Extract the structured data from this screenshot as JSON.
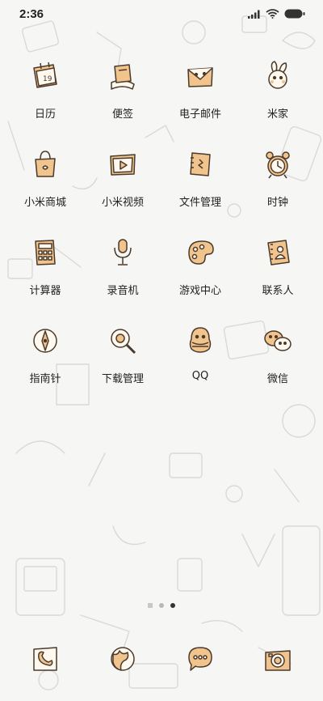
{
  "status_bar": {
    "time": "2:36",
    "icons": [
      "signal-icon",
      "wifi-icon",
      "battery-icon"
    ]
  },
  "apps": [
    {
      "label": "日历",
      "icon": "calendar-icon"
    },
    {
      "label": "便签",
      "icon": "notes-icon"
    },
    {
      "label": "电子邮件",
      "icon": "email-icon"
    },
    {
      "label": "米家",
      "icon": "mijia-icon"
    },
    {
      "label": "小米商城",
      "icon": "shopping-bag-icon"
    },
    {
      "label": "小米视频",
      "icon": "video-icon"
    },
    {
      "label": "文件管理",
      "icon": "folder-icon"
    },
    {
      "label": "时钟",
      "icon": "clock-icon"
    },
    {
      "label": "计算器",
      "icon": "calculator-icon"
    },
    {
      "label": "录音机",
      "icon": "microphone-icon"
    },
    {
      "label": "游戏中心",
      "icon": "palette-icon"
    },
    {
      "label": "联系人",
      "icon": "contacts-icon"
    },
    {
      "label": "指南针",
      "icon": "compass-icon"
    },
    {
      "label": "下载管理",
      "icon": "magnifier-icon"
    },
    {
      "label": "QQ",
      "icon": "qq-icon"
    },
    {
      "label": "微信",
      "icon": "wechat-icon"
    }
  ],
  "calendar_day": "19",
  "pager": {
    "count": 3,
    "active_index": 2
  },
  "dock": [
    {
      "icon": "phone-icon"
    },
    {
      "icon": "browser-icon"
    },
    {
      "icon": "messages-icon"
    },
    {
      "icon": "camera-icon"
    }
  ],
  "colors": {
    "icon_fill": "#f2c48d",
    "icon_stroke": "#4a3a2c",
    "background": "#f6f6f4",
    "label": "#222222"
  }
}
